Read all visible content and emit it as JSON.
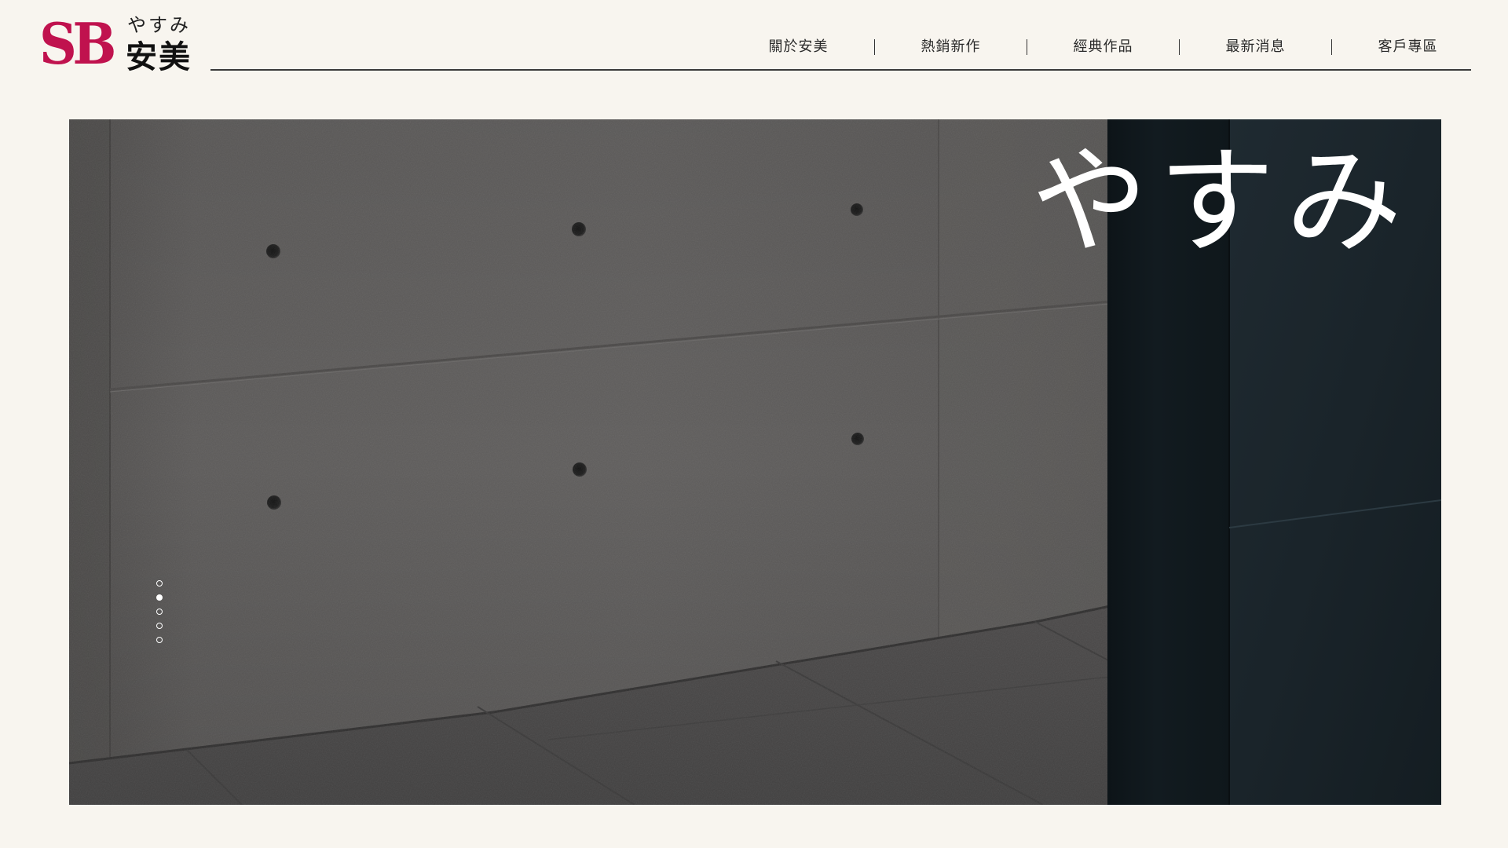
{
  "brand": {
    "mark": "SB",
    "kana": "やすみ",
    "name": "安美",
    "mark_color": "#c0124e"
  },
  "nav": {
    "items": [
      {
        "label": "關於安美"
      },
      {
        "label": "熱銷新作"
      },
      {
        "label": "經典作品"
      },
      {
        "label": "最新消息"
      },
      {
        "label": "客戶專區"
      }
    ]
  },
  "hero": {
    "title": "やすみ",
    "slides": {
      "count": 5,
      "active_index": 1
    }
  },
  "colors": {
    "background": "#f8f5ef",
    "text": "#222222",
    "rule": "#3a3a3a",
    "hero_title": "#ffffff"
  }
}
